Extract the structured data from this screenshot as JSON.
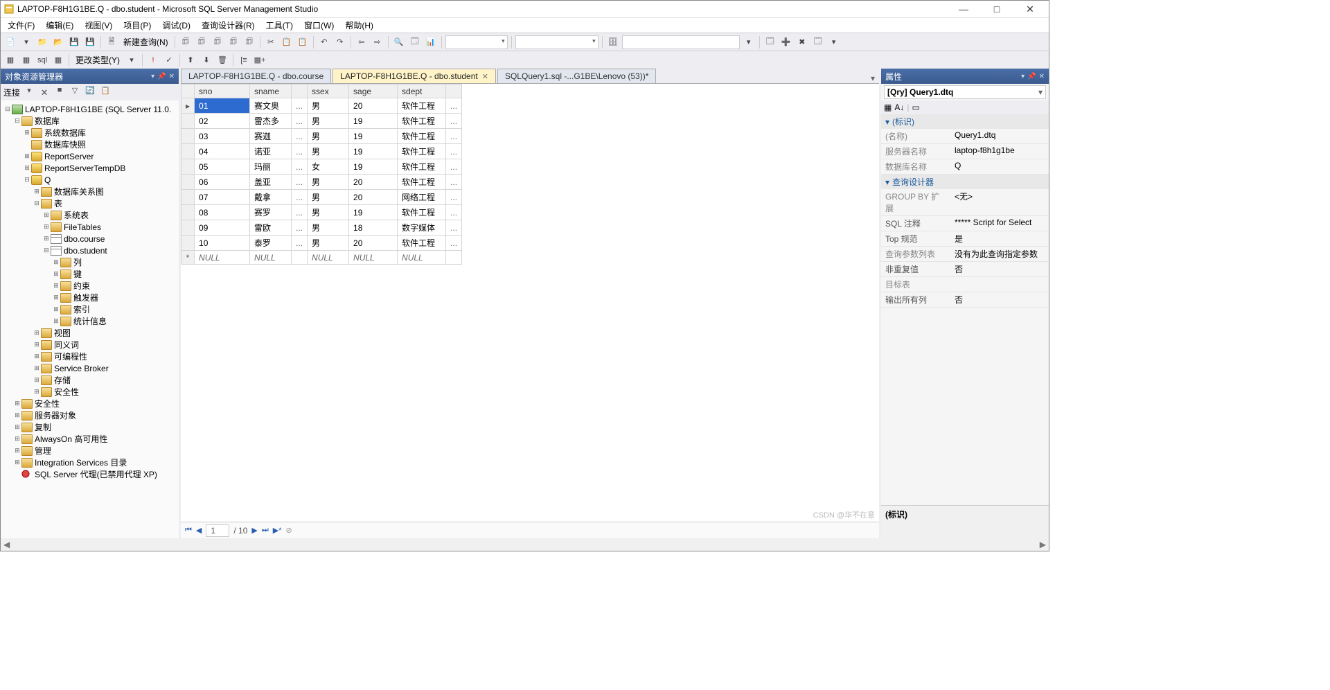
{
  "title": "LAPTOP-F8H1G1BE.Q - dbo.student - Microsoft SQL Server Management Studio",
  "menus": [
    "文件(F)",
    "编辑(E)",
    "视图(V)",
    "项目(P)",
    "调试(D)",
    "查询设计器(R)",
    "工具(T)",
    "窗口(W)",
    "帮助(H)"
  ],
  "newquery": "新建查询(N)",
  "changetype": "更改类型(Y)",
  "explorer": {
    "title": "对象资源管理器",
    "connect": "连接",
    "root": "LAPTOP-F8H1G1BE (SQL Server 11.0.",
    "nodes": {
      "db": "数据库",
      "sysdb": "系统数据库",
      "dbsnap": "数据库快照",
      "reportsrv": "ReportServer",
      "reporttmp": "ReportServerTempDB",
      "q": "Q",
      "dbdiagram": "数据库关系图",
      "tables": "表",
      "systables": "系统表",
      "filetables": "FileTables",
      "course": "dbo.course",
      "student": "dbo.student",
      "cols": "列",
      "keys": "键",
      "constraints": "约束",
      "triggers": "触发器",
      "indexes": "索引",
      "stats": "统计信息",
      "views": "视图",
      "synonyms": "同义词",
      "prog": "可编程性",
      "sbroker": "Service Broker",
      "storage": "存储",
      "security1": "安全性",
      "security2": "安全性",
      "srvobj": "服务器对象",
      "repl": "复制",
      "alwayson": "AlwaysOn 高可用性",
      "mgmt": "管理",
      "iscat": "Integration Services 目录",
      "agent": "SQL Server 代理(已禁用代理 XP)"
    }
  },
  "tabs": [
    {
      "label": "LAPTOP-F8H1G1BE.Q - dbo.course",
      "active": false
    },
    {
      "label": "LAPTOP-F8H1G1BE.Q - dbo.student",
      "active": true
    },
    {
      "label": "SQLQuery1.sql -...G1BE\\Lenovo (53))*",
      "active": false
    }
  ],
  "grid": {
    "columns": [
      "sno",
      "sname",
      "ssex",
      "sage",
      "sdept"
    ],
    "rows": [
      {
        "sno": "01",
        "sname": "赛文奥",
        "ssex": "男",
        "sage": "20",
        "sdept": "软件工程"
      },
      {
        "sno": "02",
        "sname": "雷杰多",
        "ssex": "男",
        "sage": "19",
        "sdept": "软件工程"
      },
      {
        "sno": "03",
        "sname": "赛迦",
        "ssex": "男",
        "sage": "19",
        "sdept": "软件工程"
      },
      {
        "sno": "04",
        "sname": "诺亚",
        "ssex": "男",
        "sage": "19",
        "sdept": "软件工程"
      },
      {
        "sno": "05",
        "sname": "玛丽",
        "ssex": "女",
        "sage": "19",
        "sdept": "软件工程"
      },
      {
        "sno": "06",
        "sname": "盖亚",
        "ssex": "男",
        "sage": "20",
        "sdept": "软件工程"
      },
      {
        "sno": "07",
        "sname": "戴拿",
        "ssex": "男",
        "sage": "20",
        "sdept": "网络工程"
      },
      {
        "sno": "08",
        "sname": "赛罗",
        "ssex": "男",
        "sage": "19",
        "sdept": "软件工程"
      },
      {
        "sno": "09",
        "sname": "雷欧",
        "ssex": "男",
        "sage": "18",
        "sdept": "数字媒体"
      },
      {
        "sno": "10",
        "sname": "泰罗",
        "ssex": "男",
        "sage": "20",
        "sdept": "软件工程"
      }
    ],
    "nullrow": "NULL",
    "nav": {
      "pos": "1",
      "total": "/ 10"
    }
  },
  "props": {
    "title": "属性",
    "object": "[Qry] Query1.dtq",
    "cat1": "(标识)",
    "name_k": "(名称)",
    "name_v": "Query1.dtq",
    "srv_k": "服务器名称",
    "srv_v": "laptop-f8h1g1be",
    "db_k": "数据库名称",
    "db_v": "Q",
    "cat2": "查询设计器",
    "gb_k": "GROUP BY 扩展",
    "gb_v": "<无>",
    "sql_k": "SQL 注释",
    "sql_v": "***** Script for Select",
    "top_k": "Top 规范",
    "top_v": "是",
    "param_k": "查询参数列表",
    "param_v": "没有为此查询指定参数",
    "dist_k": "非重复值",
    "dist_v": "否",
    "target_k": "目标表",
    "target_v": "",
    "outall_k": "输出所有列",
    "outall_v": "否",
    "desc": "(标识)"
  },
  "watermark": "CSDN @华不在意"
}
